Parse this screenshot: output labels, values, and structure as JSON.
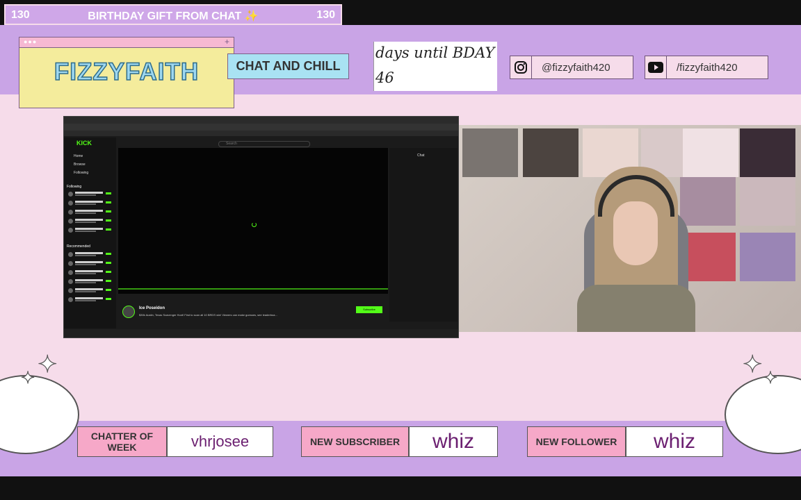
{
  "goal": {
    "left_count": "130",
    "title": "BIRTHDAY GIFT FROM CHAT ✨",
    "right_count": "130"
  },
  "brand": {
    "dots": "●●●",
    "plus": "+",
    "name": "FIZZYFAITH"
  },
  "tagline": "CHAT AND CHILL",
  "countdown": {
    "label": "days until BDAY",
    "days": "46"
  },
  "socials": {
    "instagram": {
      "icon": "instagram-icon",
      "handle": "@fizzyfaith420"
    },
    "youtube": {
      "icon": "youtube-icon",
      "handle": "/fizzyfaith420"
    }
  },
  "screen": {
    "logo": "KICK",
    "search_placeholder": "Search",
    "nav": [
      "Home",
      "Browse",
      "Following"
    ],
    "following_label": "Following",
    "recommended_label": "Recommended",
    "streamer": "Ice Poseidon",
    "description": "$30k Austin, Texas Scavenger Hunt! First to scan all 10 BRDS win! Viewers can make guesses, see leaderboa...",
    "subscribe": "Subscribe",
    "chat_title": "Chat"
  },
  "bottom": {
    "chatter": {
      "label": "CHATTER OF WEEK",
      "value": "vhrjosee"
    },
    "subscriber": {
      "label": "NEW SUBSCRIBER",
      "value": "whiz"
    },
    "follower": {
      "label": "NEW FOLLOWER",
      "value": "whiz"
    }
  },
  "colors": {
    "accent_purple": "#c9a4e6",
    "pink": "#f6dcea",
    "kick_green": "#53fc18"
  }
}
